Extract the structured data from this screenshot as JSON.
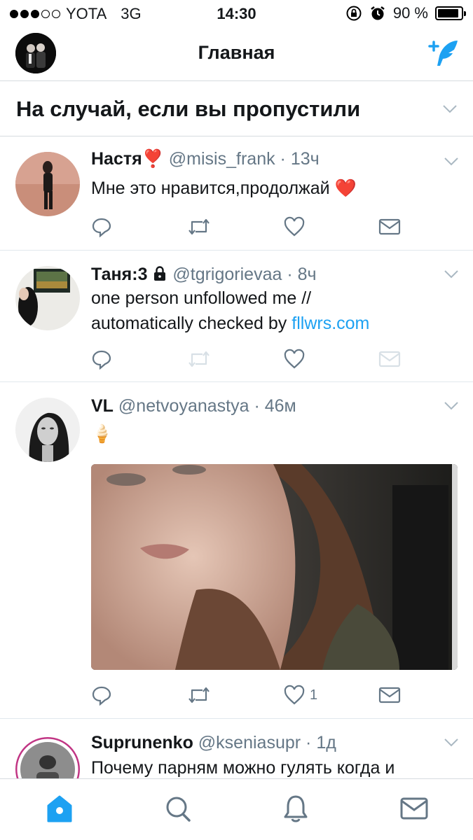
{
  "status_bar": {
    "carrier": "YOTA",
    "network": "3G",
    "time": "14:30",
    "battery": "90 %",
    "battery_level": 0.9,
    "signal_bars": 3,
    "signal_total": 5
  },
  "nav": {
    "title": "Главная",
    "compose_icon": "compose-quill-icon"
  },
  "section": {
    "title": "На случай, если вы пропустили"
  },
  "tweets": [
    {
      "name": "Настя",
      "badge": "❣️",
      "handle": "@misis_frank",
      "time": "13ч",
      "text": "Мне это нравится,продолжай ❤️",
      "like_count": ""
    },
    {
      "name": "Таня:3",
      "handle": "@tgrigorievaa",
      "time": "8ч",
      "text_line1": "one person unfollowed me //",
      "text_line2_prefix": "automatically checked by ",
      "text_link": "fllwrs.com",
      "like_count": ""
    },
    {
      "name": "VL",
      "handle": "@netvoyanastya",
      "time": "46м",
      "text": "🍦",
      "like_count": "1"
    },
    {
      "name": "Suprunenko",
      "handle": "@kseniasupr",
      "time": "1д",
      "text": "Почему парням можно гулять когда и"
    }
  ],
  "separator": "·",
  "colors": {
    "accent": "#1da1f2",
    "secondary_text": "#657786",
    "divider": "#e1e8ed"
  }
}
